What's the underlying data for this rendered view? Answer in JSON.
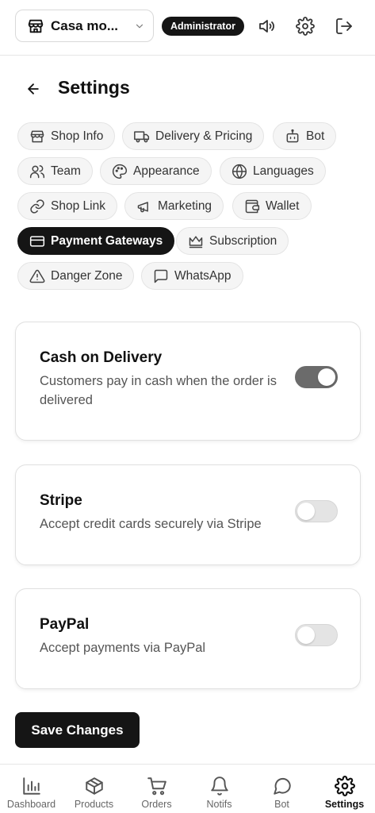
{
  "topbar": {
    "shop_name": "Casa mo...",
    "role": "Administrator"
  },
  "header": {
    "title": "Settings"
  },
  "tabs": [
    {
      "label": "Shop Info",
      "icon": "store-icon"
    },
    {
      "label": "Delivery & Pricing",
      "icon": "truck-icon"
    },
    {
      "label": "Bot",
      "icon": "bot-icon"
    },
    {
      "label": "Team",
      "icon": "users-icon"
    },
    {
      "label": "Appearance",
      "icon": "palette-icon"
    },
    {
      "label": "Languages",
      "icon": "globe-icon"
    },
    {
      "label": "Shop Link",
      "icon": "link-icon"
    },
    {
      "label": "Marketing",
      "icon": "megaphone-icon"
    },
    {
      "label": "Wallet",
      "icon": "wallet-icon"
    },
    {
      "label": "Payment Gateways",
      "icon": "credit-card-icon",
      "active": true
    },
    {
      "label": "Subscription",
      "icon": "crown-icon"
    },
    {
      "label": "Danger Zone",
      "icon": "warning-icon"
    },
    {
      "label": "WhatsApp",
      "icon": "message-square-icon"
    }
  ],
  "gateways": [
    {
      "title": "Cash on Delivery",
      "description": "Customers pay in cash when the order is delivered",
      "enabled": true
    },
    {
      "title": "Stripe",
      "description": "Accept credit cards securely via Stripe",
      "enabled": false
    },
    {
      "title": "PayPal",
      "description": "Accept payments via PayPal",
      "enabled": false
    }
  ],
  "save_label": "Save Changes",
  "bottom_nav": [
    {
      "label": "Dashboard",
      "icon": "bar-chart-icon"
    },
    {
      "label": "Products",
      "icon": "box-icon"
    },
    {
      "label": "Orders",
      "icon": "cart-icon"
    },
    {
      "label": "Notifs",
      "icon": "bell-icon"
    },
    {
      "label": "Bot",
      "icon": "chat-icon"
    },
    {
      "label": "Settings",
      "icon": "gear-icon",
      "active": true
    }
  ],
  "colors": {
    "accent": "#151515",
    "toggle_on": "#6b6b6b",
    "toggle_off": "#e4e4e4"
  }
}
